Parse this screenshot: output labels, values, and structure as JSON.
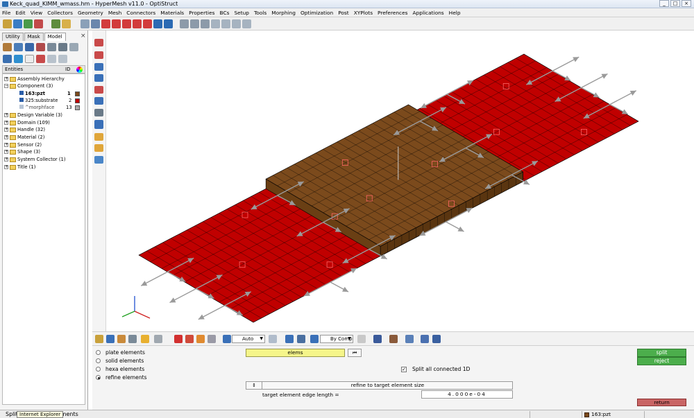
{
  "window": {
    "title": "Keck_quad_KIMM_wmass.hm - HyperMesh v11.0 - OptiStruct"
  },
  "menu": [
    "File",
    "Edit",
    "View",
    "Collectors",
    "Geometry",
    "Mesh",
    "Connectors",
    "Materials",
    "Properties",
    "BCs",
    "Setup",
    "Tools",
    "Morphing",
    "Optimization",
    "Post",
    "XYPlots",
    "Preferences",
    "Applications",
    "Help"
  ],
  "browser": {
    "tabs": [
      "Utility",
      "Mask",
      "Model"
    ],
    "header": {
      "label": "Entities",
      "id": "ID"
    },
    "tree": [
      {
        "label": "Assembly Hierarchy",
        "expander": "+"
      },
      {
        "label": "Component (3)",
        "expander": "−"
      },
      {
        "label": "163:pzt",
        "id": "1",
        "color": "#7b4a1c"
      },
      {
        "label": "325:substrate",
        "id": "2",
        "color": "#c00000"
      },
      {
        "label": "^morphface",
        "id": "13",
        "color": "#a8a8a8"
      },
      {
        "label": "Design Variable (3)",
        "expander": "+"
      },
      {
        "label": "Domain (109)",
        "expander": "+"
      },
      {
        "label": "Handle (32)",
        "expander": "+"
      },
      {
        "label": "Material (2)",
        "expander": "+"
      },
      {
        "label": "Sensor (2)",
        "expander": "+"
      },
      {
        "label": "Shape (3)",
        "expander": "+"
      },
      {
        "label": "System Collector (1)",
        "expander": "+"
      },
      {
        "label": "Title (1)",
        "expander": "+"
      }
    ]
  },
  "bottom_toolbar": {
    "auto_label": "Auto",
    "color_mode": "By Comp"
  },
  "split_panel": {
    "options": [
      "plate elements",
      "solid elements",
      "hexa elements",
      "refine elements"
    ],
    "selected_option": "refine elements",
    "elems_label": "elems",
    "split_all_label": "Split all connected 1D",
    "split_all_checked": true,
    "mode_switch": "⇕",
    "mode_label": "refine to target element size",
    "edge_length_label": "target element edge length =",
    "edge_length_value": "4.000e-04",
    "split_button": "split",
    "reject_button": "reject",
    "return_button": "return"
  },
  "status": {
    "message": "Split",
    "message_tail": "ements",
    "tooltip": "Internet Explorer",
    "component": "163:pzt"
  },
  "colors": {
    "substrate": "#c00000",
    "pzt": "#7b4a1c",
    "mesh_line": "#000000",
    "handles": "#9a9a9a"
  }
}
